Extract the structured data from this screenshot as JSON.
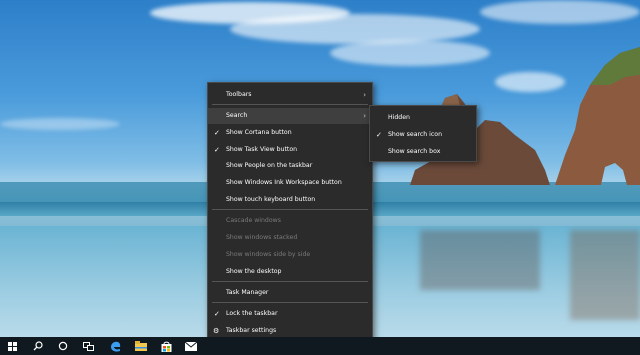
{
  "context_menu": {
    "items": [
      {
        "label": "Toolbars",
        "checked": false,
        "disabled": false,
        "submenu": true
      },
      {
        "label": "Search",
        "checked": false,
        "disabled": false,
        "submenu": true,
        "active": true
      },
      {
        "label": "Show Cortana button",
        "checked": true,
        "disabled": false
      },
      {
        "label": "Show Task View button",
        "checked": true,
        "disabled": false
      },
      {
        "label": "Show People on the taskbar",
        "checked": false,
        "disabled": false
      },
      {
        "label": "Show Windows Ink Workspace button",
        "checked": false,
        "disabled": false
      },
      {
        "label": "Show touch keyboard button",
        "checked": false,
        "disabled": false
      },
      {
        "label": "Cascade windows",
        "checked": false,
        "disabled": true
      },
      {
        "label": "Show windows stacked",
        "checked": false,
        "disabled": true
      },
      {
        "label": "Show windows side by side",
        "checked": false,
        "disabled": true
      },
      {
        "label": "Show the desktop",
        "checked": false,
        "disabled": false
      },
      {
        "label": "Task Manager",
        "checked": false,
        "disabled": false
      },
      {
        "label": "Lock the taskbar",
        "checked": true,
        "disabled": false
      },
      {
        "label": "Taskbar settings",
        "checked": false,
        "disabled": false,
        "icon": "gear-icon"
      }
    ]
  },
  "search_submenu": {
    "items": [
      {
        "label": "Hidden",
        "checked": false
      },
      {
        "label": "Show search icon",
        "checked": true
      },
      {
        "label": "Show search box",
        "checked": false
      }
    ]
  },
  "taskbar": {
    "icons": [
      "windows-start-icon",
      "search-icon",
      "cortana-icon",
      "task-view-icon",
      "edge-browser-icon",
      "file-explorer-icon",
      "store-icon",
      "mail-icon"
    ]
  },
  "colors": {
    "menu_bg": "#2b2b2b",
    "taskbar_bg": "#101820",
    "accent": "#1e90ff"
  }
}
